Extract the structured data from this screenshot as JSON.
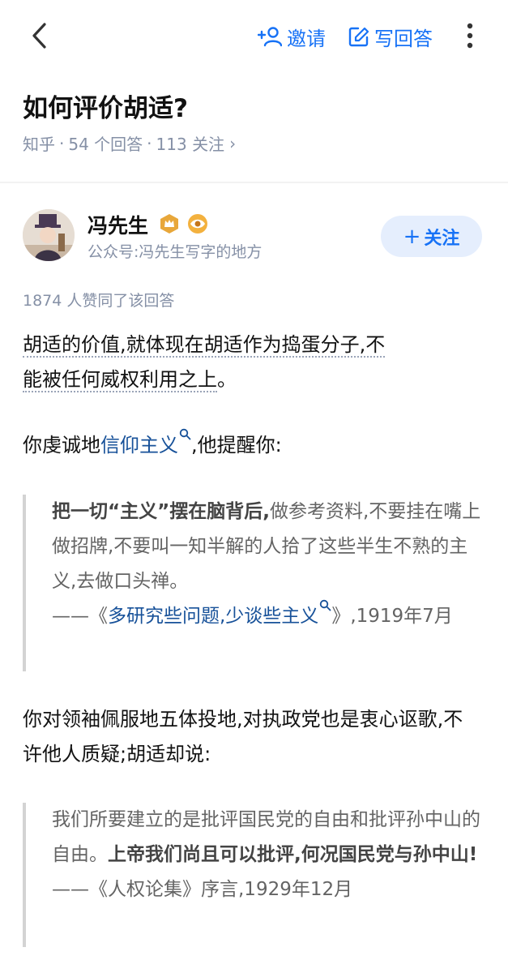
{
  "nav": {
    "invite_label": "邀请",
    "write_label": "写回答",
    "accent": "#1772f6"
  },
  "question": {
    "title": "如何评价胡适?",
    "source": "知乎",
    "answers": "54 个回答",
    "follows": "113 关注"
  },
  "author": {
    "name": "冯先生",
    "subtitle": "公众号:冯先生写字的地方",
    "follow_label": "关注"
  },
  "answer": {
    "votes": "1874 人赞同了该回答",
    "p1": "胡适的价值,就体现在胡适作为捣蛋分子,不",
    "p1_line2": "能被任何威权利用之上",
    "p1_end": "。",
    "p2_a": "你虔诚地",
    "p2_link": "信仰主义",
    "p2_b": ",他提醒你:",
    "q1_bold": "把一切“主义”摆在脑背后,",
    "q1_text": "做参考资料,不要挂在嘴上做招牌,不要叫一知半解的人拾了这些半生不熟的主义,去做口头禅。",
    "q1_dash": "——《",
    "q1_link": "多研究些问题,少谈些主义",
    "q1_cite_end": "》,1919年7月",
    "p3": "你对领袖佩服地五体投地,对执政党也是衷心讴歌,不许他人质疑;胡适却说:",
    "q2_text": "我们所要建立的是批评国民党的自由和批评孙中山的自由。",
    "q2_bold": "上帝我们尚且可以批评,何况国民党与孙中山!",
    "q2_cite": "——《人权论集》序言,1929年12月",
    "link_color": "#175199"
  }
}
